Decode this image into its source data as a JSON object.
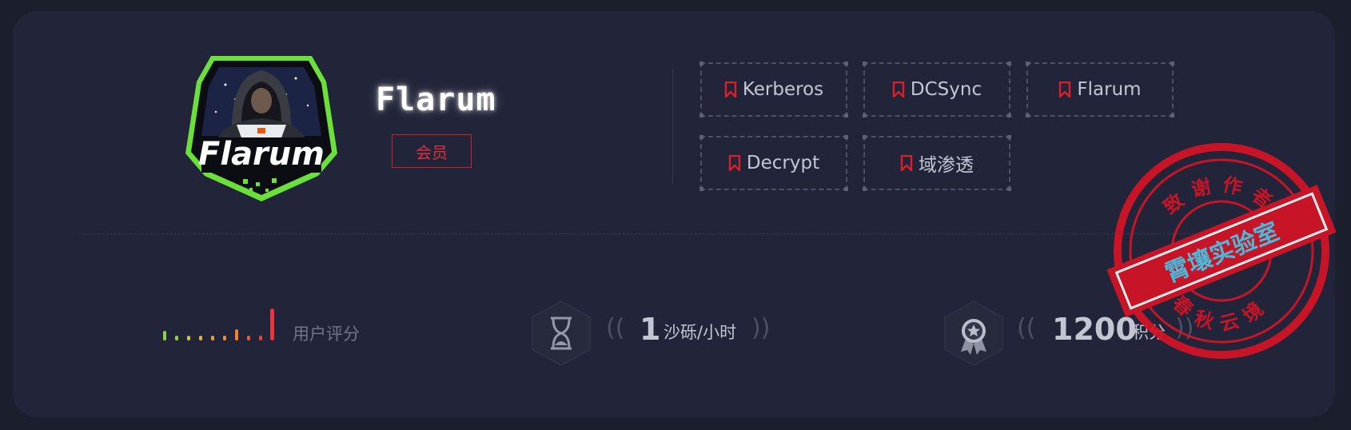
{
  "profile": {
    "name": "Flarum",
    "logo_text": "Flarum",
    "role_badge": "会员"
  },
  "tags": [
    {
      "label": "Kerberos",
      "icon": "bookmark-icon"
    },
    {
      "label": "DCSync",
      "icon": "bookmark-icon"
    },
    {
      "label": "Flarum",
      "icon": "bookmark-icon"
    },
    {
      "label": "Decrypt",
      "icon": "bookmark-icon"
    },
    {
      "label": "域渗透",
      "icon": "bookmark-icon"
    }
  ],
  "stats": {
    "rating": {
      "label": "用户评分",
      "icon": "signal-bars-icon"
    },
    "time": {
      "value": "1",
      "unit": "沙砾/小时",
      "icon": "hourglass-icon"
    },
    "points": {
      "value": "1200",
      "unit": "积分",
      "icon": "medal-icon"
    }
  },
  "stamp": {
    "top_text": "致谢作者",
    "bottom_text": "春秋云境",
    "band_text": "霄壤实验室",
    "icon": "stamp-seal-icon"
  },
  "colors": {
    "accent_red": "#e12f3a",
    "logo_green": "#6be03a",
    "stamp_red": "#d61325",
    "stamp_band_text": "#4fc6e8"
  }
}
